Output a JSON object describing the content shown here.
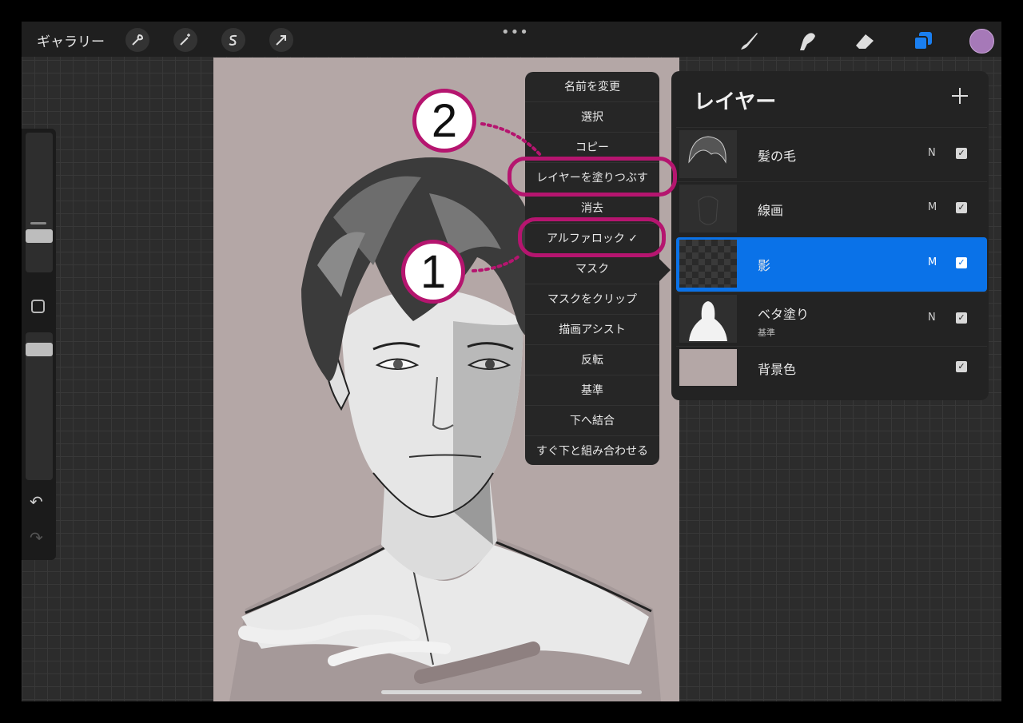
{
  "topbar": {
    "gallery_label": "ギャラリー",
    "more_label": "•••",
    "left_icons": [
      "wrench-icon",
      "magic-wand-icon",
      "selection-s-icon",
      "arrow-transform-icon"
    ],
    "right_icons": [
      "brush-icon",
      "smudge-icon",
      "eraser-icon",
      "layers-icon"
    ],
    "current_color": "#a679b8",
    "active_tool_color": "#1a7ff0"
  },
  "menu": {
    "items": [
      "名前を変更",
      "選択",
      "コピー",
      "レイヤーを塗りつぶす",
      "消去",
      "アルファロック ✓",
      "マスク",
      "マスクをクリップ",
      "描画アシスト",
      "反転",
      "基準",
      "下へ結合",
      "すぐ下と組み合わせる"
    ]
  },
  "layers": {
    "title": "レイヤー",
    "add_label": "+",
    "rows": [
      {
        "name": "髪の毛",
        "sub": "",
        "mode": "N",
        "checked": true
      },
      {
        "name": "線画",
        "sub": "",
        "mode": "M",
        "checked": true
      },
      {
        "name": "影",
        "sub": "",
        "mode": "M",
        "checked": true,
        "selected": true
      },
      {
        "name": "ベタ塗り",
        "sub": "基準",
        "mode": "N",
        "checked": true
      },
      {
        "name": "背景色",
        "sub": "",
        "mode": "",
        "checked": true
      }
    ]
  },
  "annotations": {
    "badge_1": "1",
    "badge_2": "2",
    "highlight_color": "#b5156f"
  },
  "canvas": {
    "background": "#b4a7a6"
  }
}
